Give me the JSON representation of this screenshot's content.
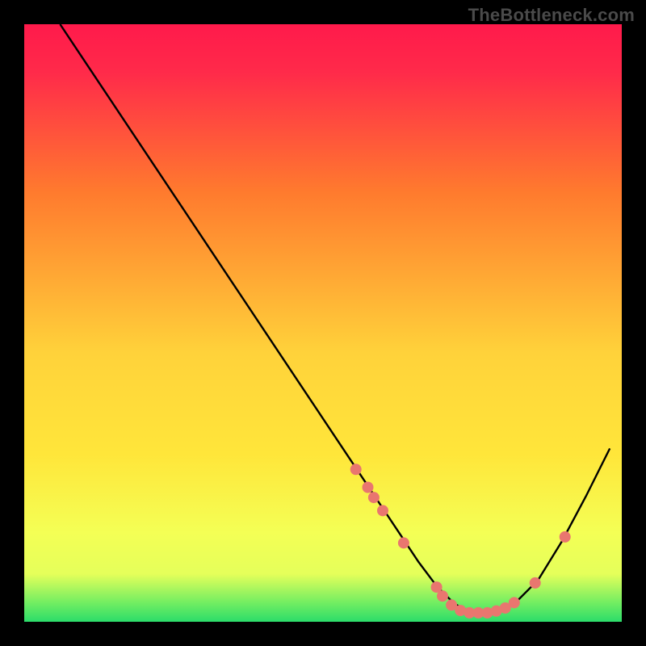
{
  "watermark": "TheBottleneck.com",
  "chart_data": {
    "type": "line",
    "title": "",
    "xlabel": "",
    "ylabel": "",
    "xlim": [
      0,
      100
    ],
    "ylim": [
      0,
      100
    ],
    "gradient_colors": {
      "top": "#ff1a4b",
      "upper_mid": "#ff7a2e",
      "mid": "#ffe63a",
      "lower": "#e5ff5a",
      "bottom": "#2bdc6a"
    },
    "notes": "V-shaped bottleneck curve over vertical heat gradient (red→orange→yellow→green). Flat minimum near bottom with pink markers clustered on the descending limb, flat valley, and one on the ascending limb.",
    "series": [
      {
        "name": "bottleneck-curve",
        "x": [
          6,
          10,
          15,
          20,
          25,
          30,
          35,
          40,
          45,
          50,
          55,
          57,
          60,
          63,
          66,
          69,
          72,
          75,
          78,
          82,
          86,
          90,
          94,
          98
        ],
        "y": [
          100,
          94,
          86.5,
          79,
          71.5,
          64,
          56.5,
          49,
          41.5,
          34,
          26.5,
          23.5,
          19,
          14.5,
          10,
          6,
          3,
          1.5,
          1.5,
          3,
          7,
          13.5,
          21,
          29
        ]
      }
    ],
    "markers": {
      "name": "highlight-points",
      "color": "#e9766f",
      "radius": 7,
      "points": [
        {
          "x": 55.5,
          "y": 25.5
        },
        {
          "x": 57.5,
          "y": 22.5
        },
        {
          "x": 58.5,
          "y": 20.8
        },
        {
          "x": 60.0,
          "y": 18.6
        },
        {
          "x": 63.5,
          "y": 13.2
        },
        {
          "x": 69.0,
          "y": 5.8
        },
        {
          "x": 70.0,
          "y": 4.3
        },
        {
          "x": 71.5,
          "y": 2.8
        },
        {
          "x": 73.0,
          "y": 1.9
        },
        {
          "x": 74.5,
          "y": 1.5
        },
        {
          "x": 76.0,
          "y": 1.5
        },
        {
          "x": 77.5,
          "y": 1.5
        },
        {
          "x": 79.0,
          "y": 1.8
        },
        {
          "x": 80.5,
          "y": 2.3
        },
        {
          "x": 82.0,
          "y": 3.2
        },
        {
          "x": 85.5,
          "y": 6.5
        },
        {
          "x": 90.5,
          "y": 14.2
        }
      ]
    }
  }
}
